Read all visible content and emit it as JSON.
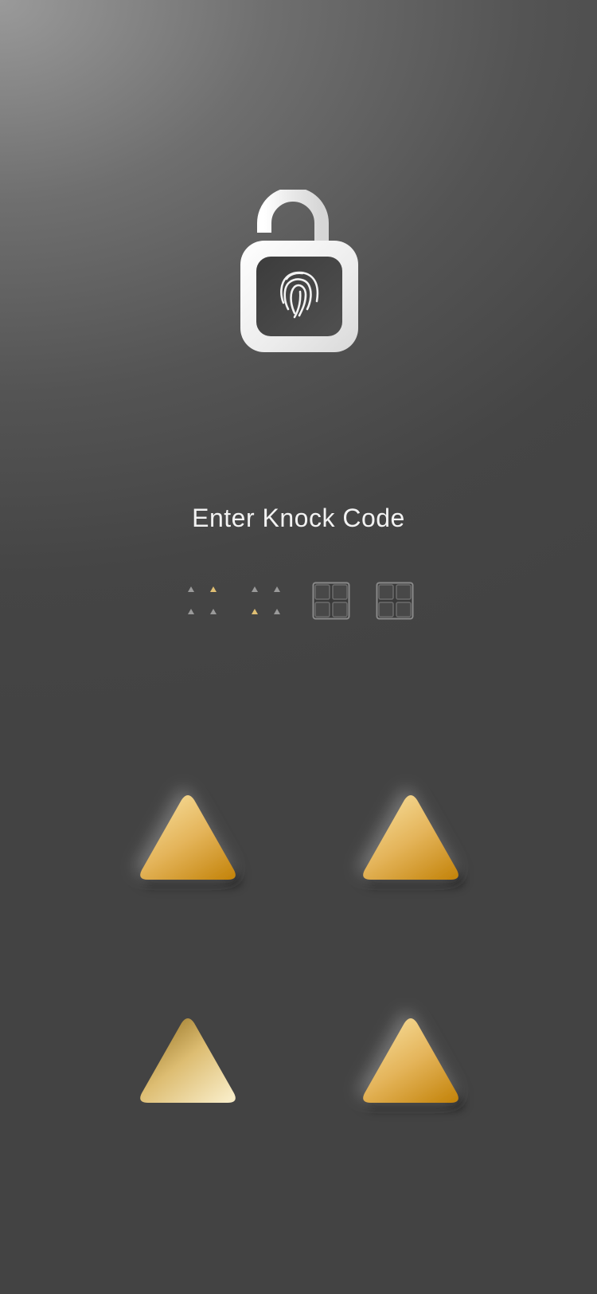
{
  "title": "Enter Knock Code",
  "icons": {
    "lock": "fingerprint-padlock-icon",
    "entered": "triangle-dot-cluster-icon",
    "empty": "quadrant-grid-icon",
    "pad": "triangle-icon"
  },
  "code": {
    "length": 4,
    "entered": 2,
    "slots": [
      {
        "state": "entered",
        "highlight_quadrant": "top-right"
      },
      {
        "state": "entered",
        "highlight_quadrant": "bottom-left"
      },
      {
        "state": "empty"
      },
      {
        "state": "empty"
      }
    ]
  },
  "pads": [
    {
      "position": "top-left",
      "state": "raised"
    },
    {
      "position": "top-right",
      "state": "raised"
    },
    {
      "position": "bottom-left",
      "state": "pressed"
    },
    {
      "position": "bottom-right",
      "state": "raised"
    }
  ],
  "colors": {
    "background": "#434343",
    "text": "#f2f2f2",
    "gold_light": "#f3d58a",
    "gold_dark": "#c98c16",
    "lock_white": "#f4f4f4"
  }
}
